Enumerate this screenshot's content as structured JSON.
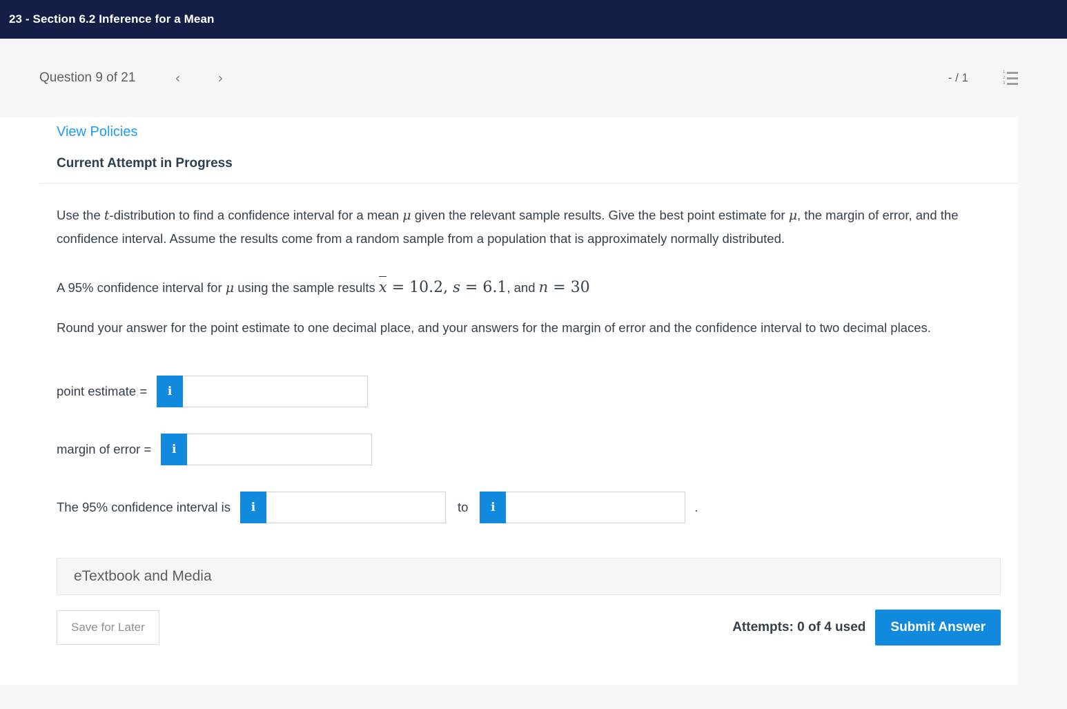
{
  "header": {
    "title": "23 - Section 6.2 Inference for a Mean"
  },
  "question_bar": {
    "question_label": "Question 9 of 21",
    "prev_icon": "chevron-left-icon",
    "next_icon": "chevron-right-icon",
    "prev_glyph": "‹",
    "next_glyph": "›",
    "score": "- / 1",
    "list_icon": "numbered-list-icon",
    "list_numbers": [
      "1",
      "2",
      "3"
    ]
  },
  "card": {
    "view_policies": "View Policies",
    "attempt_heading": "Current Attempt in Progress"
  },
  "problem": {
    "paragraph1_a": "Use the ",
    "paragraph1_t": "t",
    "paragraph1_b": "-distribution to find a confidence interval for a mean ",
    "paragraph1_mu": "μ",
    "paragraph1_c": " given the relevant sample results. Give the best point estimate for ",
    "paragraph1_mu2": "μ",
    "paragraph1_d": ", the margin of error, and the confidence interval. Assume the results come from a random sample from a population that is approximately normally distributed.",
    "math_lead": "A 95% confidence interval for ",
    "math_mu": "μ",
    "math_mid": " using the sample results ",
    "math_xbar": "x",
    "math_eq1": " =  10.2",
    "math_comma1": ", ",
    "math_s": "s",
    "math_eq2": " =  6.1",
    "math_comma2": ", and ",
    "math_n": "n",
    "math_eq3": " =  30",
    "rounding": "Round your answer for the point estimate to one decimal place, and your answers for the margin of error and the confidence interval to two decimal places."
  },
  "answers": {
    "info_icon": "info-icon",
    "info_glyph": "i",
    "point_estimate_label": "point estimate =",
    "point_estimate_value": "",
    "margin_of_error_label": "margin of error =",
    "margin_of_error_value": "",
    "ci_label": "The 95% confidence interval is",
    "ci_lower_value": "",
    "ci_to": "to",
    "ci_upper_value": "",
    "ci_period": "."
  },
  "etextbook": {
    "label": "eTextbook and Media"
  },
  "footer": {
    "save_label": "Save for Later",
    "attempts": "Attempts: 0 of 4 used",
    "submit_label": "Submit Answer"
  },
  "colors": {
    "header_navy": "#141f48",
    "accent_blue": "#1189dd",
    "link_blue": "#1d9bf0",
    "text_dark": "#34414d",
    "grey_band": "#f6f6f6"
  }
}
